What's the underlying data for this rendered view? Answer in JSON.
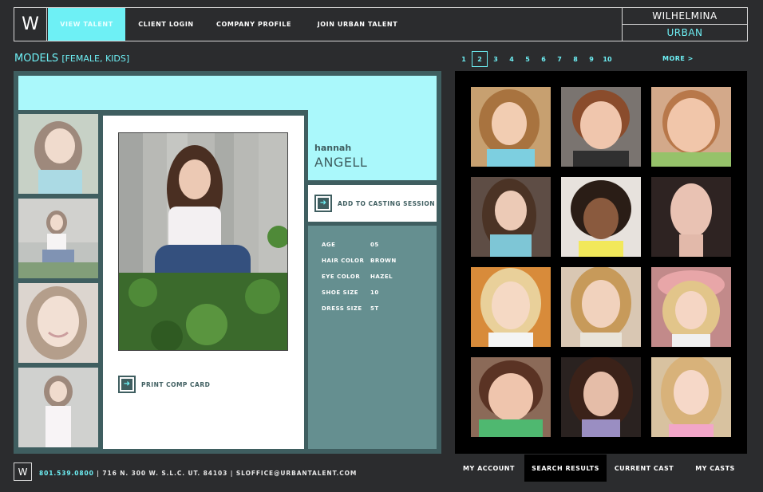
{
  "header": {
    "logo_letter": "W",
    "nav": [
      "VIEW TALENT",
      "CLIENT LOGIN",
      "COMPANY PROFILE",
      "JOIN URBAN TALENT"
    ],
    "brand_top": "WILHELMINA",
    "brand_bottom": "URBAN"
  },
  "heading": {
    "title": "MODELS",
    "filter": "[FEMALE, KIDS]"
  },
  "pagination": {
    "pages": [
      "1",
      "2",
      "3",
      "4",
      "5",
      "6",
      "7",
      "8",
      "9",
      "10"
    ],
    "current": "2",
    "more_label": "MORE >"
  },
  "profile": {
    "first_name": "hannah",
    "last_name": "ANGELL",
    "add_to_casting_label": "ADD TO CASTING SESSION",
    "print_label": "PRINT COMP CARD",
    "stats": [
      {
        "key": "AGE",
        "value": "05"
      },
      {
        "key": "HAIR COLOR",
        "value": "BROWN"
      },
      {
        "key": "EYE COLOR",
        "value": "HAZEL"
      },
      {
        "key": "SHOE SIZE",
        "value": "10"
      },
      {
        "key": "DRESS SIZE",
        "value": "5T"
      }
    ]
  },
  "footer": {
    "logo_letter": "W",
    "phone": "801.539.0800",
    "address": " | 716 N. 300 W. S.L.C. UT. 84103 | SLOFFICE@URBANTALENT.COM",
    "nav": [
      "MY ACCOUNT",
      "SEARCH RESULTS",
      "CURRENT CAST",
      "MY CASTS"
    ]
  },
  "colors": {
    "accent": "#6ef0f5",
    "panel": "#3f5e60",
    "stats_bg": "#658f90",
    "light_cyan": "#aaf8fb"
  }
}
